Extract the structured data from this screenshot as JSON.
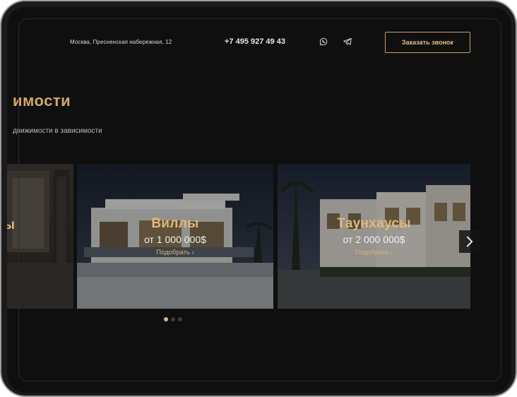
{
  "header": {
    "address": "Москва, Пресненская набережная, 12",
    "phone": "+7 495 927 49 43",
    "whatsapp_icon": "whatsapp-icon",
    "telegram_icon": "telegram-icon",
    "cta_label": "Заказать звонок"
  },
  "section": {
    "title": "имости",
    "subtitle": "движимости в зависимости"
  },
  "cards": [
    {
      "title": "ы",
      "price": "",
      "link": ""
    },
    {
      "title": "Виллы",
      "price": "от 1 000 000$",
      "link": "Подобрать ›"
    },
    {
      "title": "Таунхаусы",
      "price": "от 2 000 000$",
      "link": "Подобрать ›"
    }
  ],
  "carousel": {
    "next_icon": "chevron-right-icon",
    "slide_count": 3,
    "active_slide": 1
  },
  "colors": {
    "accent": "#d2a86a",
    "background": "#0f0f10"
  }
}
